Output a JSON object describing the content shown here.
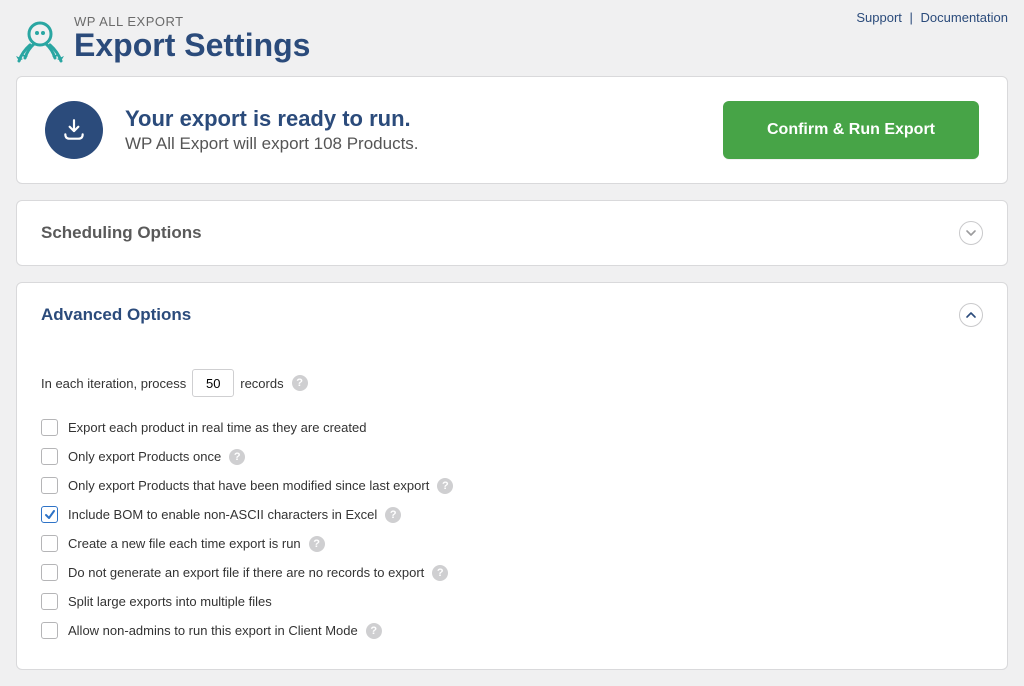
{
  "header": {
    "suptitle": "WP ALL EXPORT",
    "title": "Export Settings",
    "links": {
      "support": "Support",
      "documentation": "Documentation"
    }
  },
  "ready": {
    "heading": "Your export is ready to run.",
    "sub": "WP All Export will export 108 Products.",
    "button": "Confirm & Run Export"
  },
  "scheduling": {
    "title": "Scheduling Options"
  },
  "advanced": {
    "title": "Advanced Options",
    "iteration": {
      "prefix": "In each iteration, process",
      "value": "50",
      "suffix": "records"
    },
    "options": [
      {
        "label": "Export each product in real time as they are created",
        "checked": false,
        "help": false
      },
      {
        "label": "Only export Products once",
        "checked": false,
        "help": true
      },
      {
        "label": "Only export Products that have been modified since last export",
        "checked": false,
        "help": true
      },
      {
        "label": "Include BOM to enable non-ASCII characters in Excel",
        "checked": true,
        "help": true
      },
      {
        "label": "Create a new file each time export is run",
        "checked": false,
        "help": true
      },
      {
        "label": "Do not generate an export file if there are no records to export",
        "checked": false,
        "help": true
      },
      {
        "label": "Split large exports into multiple files",
        "checked": false,
        "help": false
      },
      {
        "label": "Allow non-admins to run this export in Client Mode",
        "checked": false,
        "help": true
      }
    ]
  }
}
